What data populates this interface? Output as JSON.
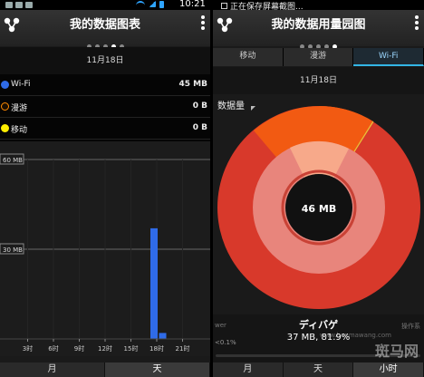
{
  "status_bar": {
    "time": "10:21",
    "notification": "正在保存屏幕截图..."
  },
  "left": {
    "title": "我的数据图表",
    "date": "11月18日",
    "legend": [
      {
        "name": "Wi-Fi",
        "value": "45 MB",
        "color": "#2f6be8"
      },
      {
        "name": "漫游",
        "value": "0 B",
        "color": "#ff8a00"
      },
      {
        "name": "移动",
        "value": "0 B",
        "color": "#ffee00"
      }
    ],
    "y_labels": [
      "60 MB",
      "30 MB"
    ],
    "bottom_tabs": [
      "月",
      "天"
    ]
  },
  "chart_data": {
    "type": "bar",
    "categories": [
      "3时",
      "6时",
      "9时",
      "12时",
      "15时",
      "18时",
      "21时"
    ],
    "x_hours": [
      18,
      19
    ],
    "values": [
      37,
      2
    ],
    "yticks": [
      "30 MB",
      "60 MB"
    ],
    "ylim": [
      0,
      60
    ],
    "xlim": [
      0,
      24
    ],
    "series_color": "#2f6be8"
  },
  "right": {
    "title": "我的数据用量园图",
    "tabs": [
      "移动",
      "漫游",
      "Wi-Fi"
    ],
    "active_tab": "Wi-Fi",
    "date": "11月18日",
    "unit_label": "数据量",
    "center_value": "46 MB",
    "footer_title": "ディバゲ",
    "footer_value": "37 MB, 81.9%",
    "footer_left_1": "wer",
    "footer_left_2": "<0.1%",
    "footer_right": "操作系",
    "bottom_tabs": [
      "月",
      "天",
      "小时"
    ],
    "colors": {
      "outer_main": "#d8392b",
      "outer_secondary": "#f25a12",
      "inner_main": "#e8857c",
      "inner_secondary": "#f7a98a",
      "center": "#111111"
    }
  },
  "watermark": {
    "text": "斑马网",
    "url": "www.banmawang.com"
  }
}
